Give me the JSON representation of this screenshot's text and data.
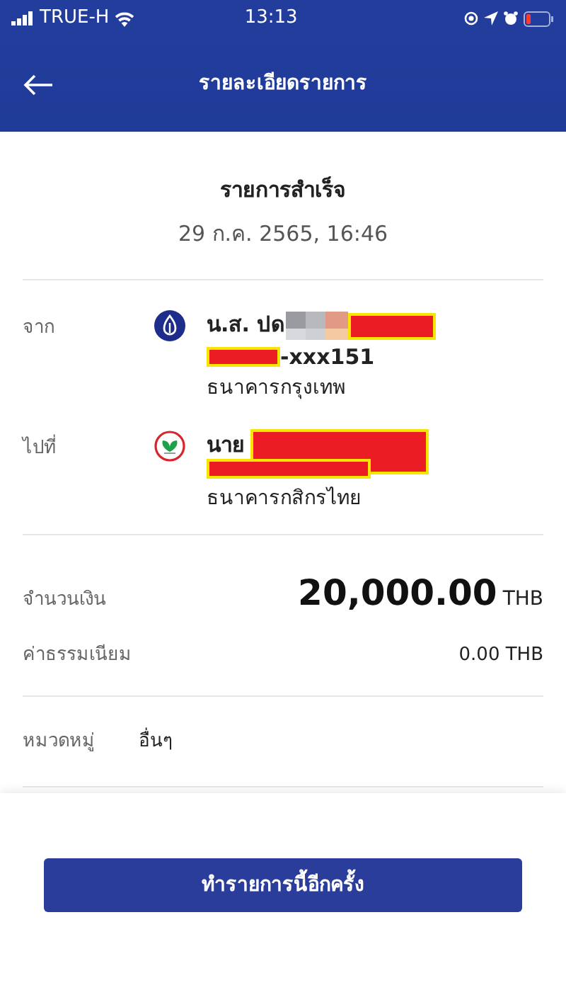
{
  "status_bar": {
    "carrier": "TRUE-H",
    "time": "13:13"
  },
  "header": {
    "title": "รายละเอียดรายการ"
  },
  "summary": {
    "status": "รายการสำเร็จ",
    "date": "29 ก.ค. 2565, 16:46"
  },
  "parties": [
    {
      "label": "จาก",
      "kind": "bbl",
      "name": "น.ส. ปด",
      "account": "-xxx151",
      "bank": "ธนาคารกรุงเทพ"
    },
    {
      "label": "ไปที่",
      "kind": "kbank",
      "name": "นาย",
      "bank": "ธนาคารกสิกรไทย"
    }
  ],
  "amount": {
    "label": "จำนวนเงิน",
    "value": "20,000.00",
    "currency": "THB"
  },
  "fee": {
    "label": "ค่าธรรมเนียม",
    "value": "0.00 THB"
  },
  "category": {
    "label": "หมวดหมู่",
    "value": "อื่นๆ"
  },
  "action_button": "ทำรายการนี้อีกครั้ง"
}
